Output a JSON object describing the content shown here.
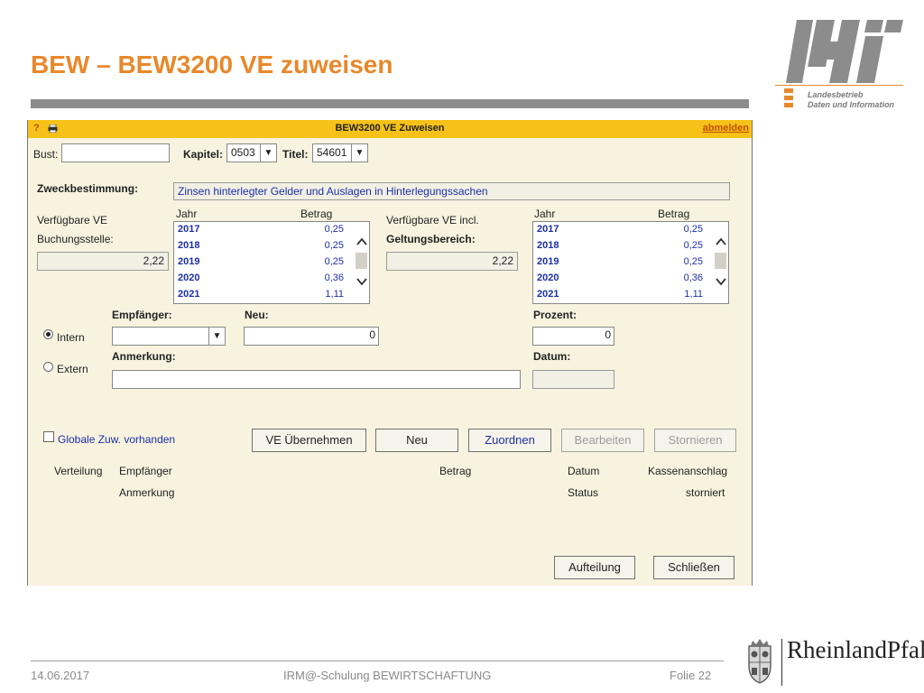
{
  "slide": {
    "title": "BEW – BEW3200 VE zuweisen",
    "footer_date": "14.06.2017",
    "footer_center": "IRM@-Schulung BEWIRTSCHAFTUNG",
    "footer_page": "Folie 22"
  },
  "logo": {
    "line1": "Landesbetrieb",
    "line2": "Daten und Information",
    "state_name": "RheinlandPfalz"
  },
  "app": {
    "header": {
      "help": "?",
      "title": "BEW3200 VE Zuweisen",
      "logout": "abmelden"
    },
    "filter": {
      "bust_label": "Bust:",
      "bust_value": "",
      "kapitel_label": "Kapitel:",
      "kapitel_value": "0503",
      "titel_label": "Titel:",
      "titel_value": "54601"
    },
    "zweck": {
      "label": "Zweckbestimmung:",
      "value": "Zinsen hinterlegter Gelder und Auslagen in Hinterlegungssachen"
    },
    "left_panel": {
      "label_line1": "Verfügbare VE",
      "label_line2": "Buchungsstelle:",
      "value": "2,22",
      "col_jahr": "Jahr",
      "col_betrag": "Betrag",
      "rows": [
        {
          "year": "2017",
          "amount": "0,25"
        },
        {
          "year": "2018",
          "amount": "0,25"
        },
        {
          "year": "2019",
          "amount": "0,25"
        },
        {
          "year": "2020",
          "amount": "0,36"
        },
        {
          "year": "2021",
          "amount": "1,11"
        }
      ]
    },
    "right_panel": {
      "label_line1": "Verfügbare VE incl.",
      "label_line2": "Geltungsbereich:",
      "value": "2,22",
      "col_jahr": "Jahr",
      "col_betrag": "Betrag",
      "rows": [
        {
          "year": "2017",
          "amount": "0,25"
        },
        {
          "year": "2018",
          "amount": "0,25"
        },
        {
          "year": "2019",
          "amount": "0,25"
        },
        {
          "year": "2020",
          "amount": "0,36"
        },
        {
          "year": "2021",
          "amount": "1,11"
        }
      ]
    },
    "form": {
      "empfaenger_label": "Empfänger:",
      "empfaenger_value": "",
      "neu_label": "Neu:",
      "neu_value": "0",
      "prozent_label": "Prozent:",
      "prozent_value": "0",
      "intern_label": "Intern",
      "extern_label": "Extern",
      "anmerkung_label": "Anmerkung:",
      "anmerkung_value": "",
      "datum_label": "Datum:",
      "datum_value": "",
      "globale_label": "Globale Zuw. vorhanden"
    },
    "buttons": {
      "uebernehmen": "VE Übernehmen",
      "neu": "Neu",
      "zuordnen": "Zuordnen",
      "bearbeiten": "Bearbeiten",
      "stornieren": "Stornieren",
      "aufteilung": "Aufteilung",
      "schliessen": "Schließen"
    },
    "table": {
      "verteilung": "Verteilung",
      "empfaenger": "Empfänger",
      "betrag": "Betrag",
      "datum": "Datum",
      "kassenanschlag": "Kassenanschlag",
      "anmerkung": "Anmerkung",
      "status": "Status",
      "storniert": "storniert"
    }
  }
}
